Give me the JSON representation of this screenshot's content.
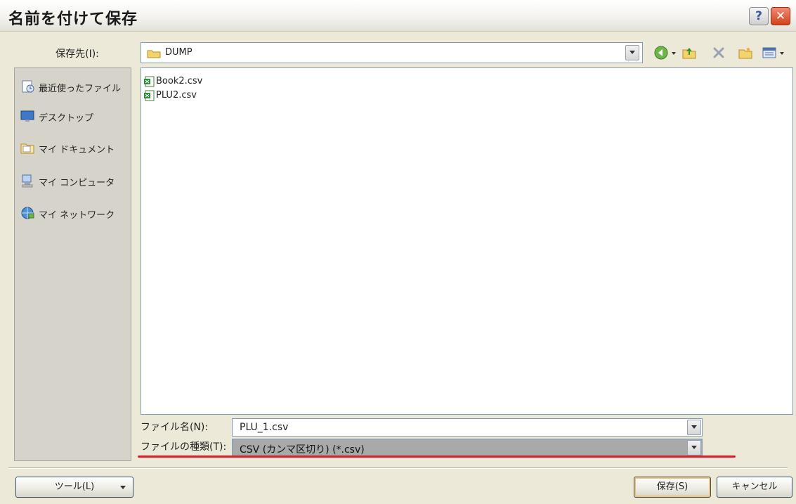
{
  "window": {
    "title": "名前を付けて保存",
    "help_label": "?",
    "close_label": "✕"
  },
  "location": {
    "label": "保存先(I):",
    "value": "DUMP"
  },
  "places": [
    {
      "label": "最近使ったファイル",
      "icon": "recent-files-icon"
    },
    {
      "label": "デスクトップ",
      "icon": "desktop-icon"
    },
    {
      "label": "マイ ドキュメント",
      "icon": "my-documents-icon"
    },
    {
      "label": "マイ コンピュータ",
      "icon": "my-computer-icon"
    },
    {
      "label": "マイ ネットワーク",
      "icon": "my-network-icon"
    }
  ],
  "files": [
    {
      "name": "Book2.csv",
      "icon": "excel-csv-icon"
    },
    {
      "name": "PLU2.csv",
      "icon": "excel-csv-icon"
    }
  ],
  "filename": {
    "label": "ファイル名(N):",
    "value": "PLU_1.csv"
  },
  "filetype": {
    "label": "ファイルの種類(T):",
    "value": "CSV (カンマ区切り) (*.csv)"
  },
  "buttons": {
    "tools": "ツール(L)",
    "save": "保存(S)",
    "cancel": "キャンセル"
  },
  "colors": {
    "highlight_underline": "#d81e2a",
    "close_button": "#d2421e",
    "dialog_bg": "#ece9d8"
  }
}
